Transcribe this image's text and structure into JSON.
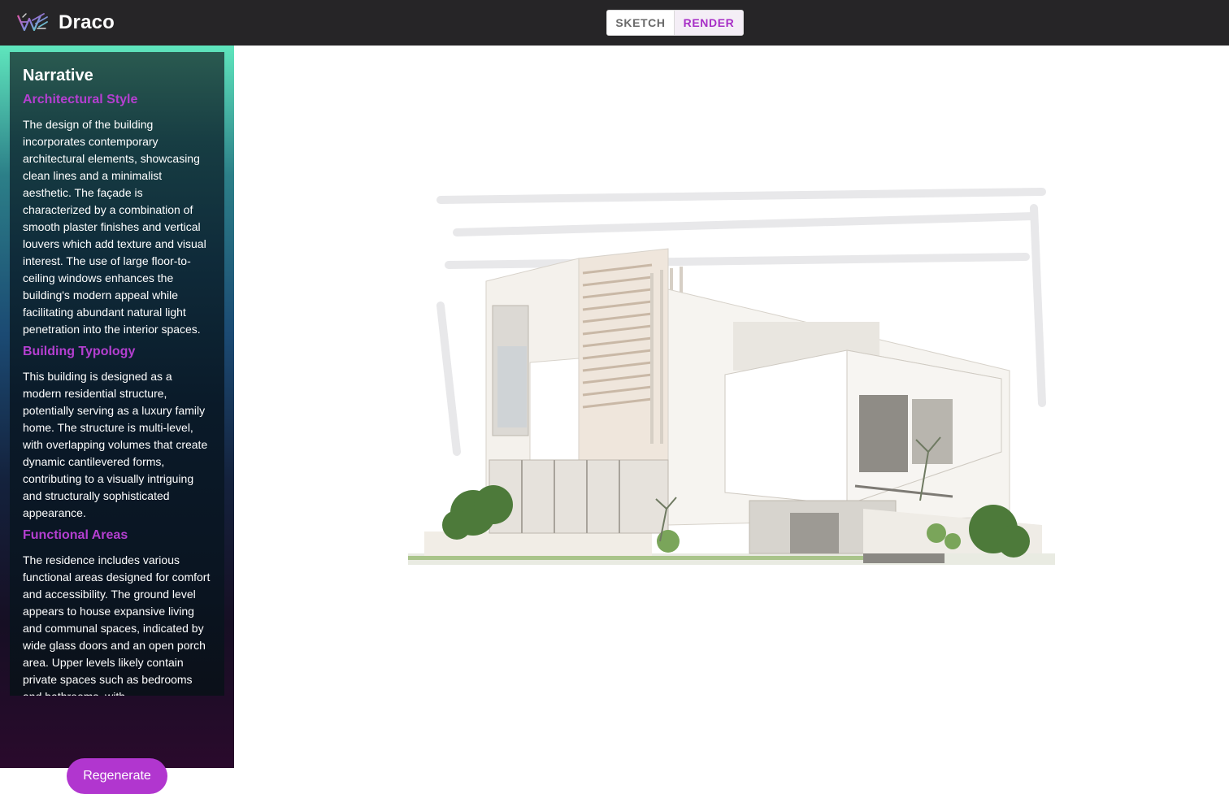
{
  "app": {
    "name": "Draco",
    "logo_icon": "draco-logo-icon"
  },
  "mode_toggle": {
    "options": [
      "SKETCH",
      "RENDER"
    ],
    "active": "RENDER"
  },
  "narrative": {
    "title": "Narrative",
    "sections": [
      {
        "heading": "Architectural Style",
        "body": "The design of the building incorporates contemporary architectural elements, showcasing clean lines and a minimalist aesthetic. The façade is characterized by a combination of smooth plaster finishes and vertical louvers which add texture and visual interest. The use of large floor-to-ceiling windows enhances the building's modern appeal while facilitating abundant natural light penetration into the interior spaces."
      },
      {
        "heading": "Building Typology",
        "body": "This building is designed as a modern residential structure, potentially serving as a luxury family home. The structure is multi-level, with overlapping volumes that create dynamic cantilevered forms, contributing to a visually intriguing and structurally sophisticated appearance."
      },
      {
        "heading": "Functional Areas",
        "body": "The residence includes various functional areas designed for comfort and accessibility. The ground level appears to house expansive living and communal spaces, indicated by wide glass doors and an open porch area. Upper levels likely contain private spaces such as bedrooms and bathrooms, with"
      }
    ]
  },
  "actions": {
    "regenerate_label": "Regenerate"
  },
  "colors": {
    "accent": "#b136cf",
    "topbar": "#262527",
    "heading": "#b43fd0"
  }
}
